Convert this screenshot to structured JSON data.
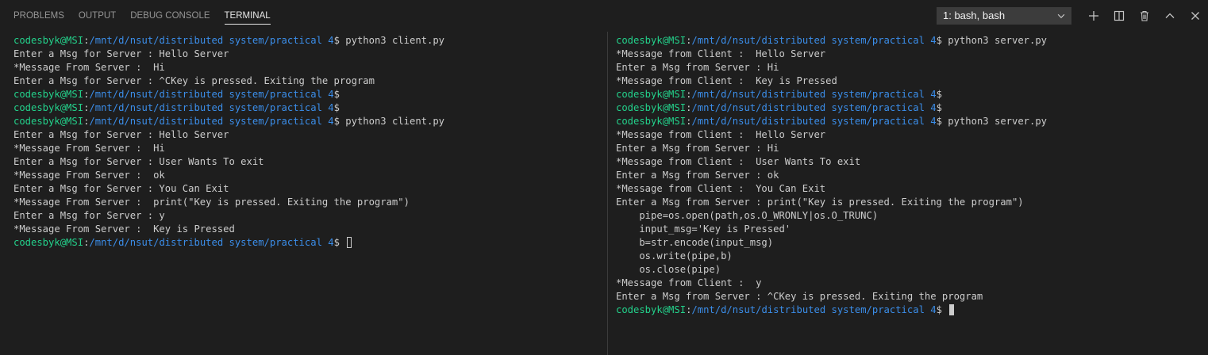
{
  "panel": {
    "tabs": [
      {
        "label": "PROBLEMS",
        "active": false
      },
      {
        "label": "OUTPUT",
        "active": false
      },
      {
        "label": "DEBUG CONSOLE",
        "active": false
      },
      {
        "label": "TERMINAL",
        "active": true
      }
    ],
    "terminal_select": {
      "selected": "1: bash, bash"
    },
    "icons": {
      "new_terminal": "plus-icon",
      "split": "split-editor-icon",
      "kill": "trash-icon",
      "maximize": "chevron-up-icon",
      "close": "close-icon"
    }
  },
  "colors": {
    "background": "#1e1e1e",
    "prompt_user": "#23d18b",
    "prompt_path": "#3b8eea",
    "text": "#cccccc"
  },
  "prompt": {
    "user": "codesbyk@MSI",
    "sep": ":",
    "path": "/mnt/d/nsut/distributed system/practical 4",
    "symbol": "$ "
  },
  "terminals": {
    "left": {
      "lines": [
        {
          "type": "prompt",
          "cmd": "python3 client.py"
        },
        {
          "type": "out",
          "text": "Enter a Msg for Server : Hello Server"
        },
        {
          "type": "out",
          "text": "*Message From Server :  Hi"
        },
        {
          "type": "out",
          "text": "Enter a Msg for Server : ^CKey is pressed. Exiting the program"
        },
        {
          "type": "prompt",
          "cmd": ""
        },
        {
          "type": "prompt",
          "cmd": ""
        },
        {
          "type": "prompt",
          "cmd": "python3 client.py"
        },
        {
          "type": "out",
          "text": "Enter a Msg for Server : Hello Server"
        },
        {
          "type": "out",
          "text": "*Message From Server :  Hi"
        },
        {
          "type": "out",
          "text": "Enter a Msg for Server : User Wants To exit"
        },
        {
          "type": "out",
          "text": "*Message From Server :  ok"
        },
        {
          "type": "out",
          "text": "Enter a Msg for Server : You Can Exit"
        },
        {
          "type": "out",
          "text": "*Message From Server :  print(\"Key is pressed. Exiting the program\")"
        },
        {
          "type": "out",
          "text": "Enter a Msg for Server : y"
        },
        {
          "type": "out",
          "text": "*Message From Server :  Key is Pressed"
        },
        {
          "type": "prompt",
          "cmd": "",
          "cursor": "hollow"
        }
      ]
    },
    "right": {
      "lines": [
        {
          "type": "prompt",
          "cmd": "python3 server.py"
        },
        {
          "type": "out",
          "text": "*Message from Client :  Hello Server"
        },
        {
          "type": "out",
          "text": "Enter a Msg from Server : Hi"
        },
        {
          "type": "out",
          "text": "*Message from Client :  Key is Pressed"
        },
        {
          "type": "prompt",
          "cmd": ""
        },
        {
          "type": "prompt",
          "cmd": ""
        },
        {
          "type": "prompt",
          "cmd": "python3 server.py"
        },
        {
          "type": "out",
          "text": "*Message from Client :  Hello Server"
        },
        {
          "type": "out",
          "text": "Enter a Msg from Server : Hi"
        },
        {
          "type": "out",
          "text": "*Message from Client :  User Wants To exit"
        },
        {
          "type": "out",
          "text": "Enter a Msg from Server : ok"
        },
        {
          "type": "out",
          "text": "*Message from Client :  You Can Exit"
        },
        {
          "type": "out",
          "text": "Enter a Msg from Server : print(\"Key is pressed. Exiting the program\")"
        },
        {
          "type": "out",
          "text": "    pipe=os.open(path,os.O_WRONLY|os.O_TRUNC)"
        },
        {
          "type": "out",
          "text": "    input_msg='Key is Pressed'"
        },
        {
          "type": "out",
          "text": "    b=str.encode(input_msg)"
        },
        {
          "type": "out",
          "text": "    os.write(pipe,b)"
        },
        {
          "type": "out",
          "text": "    os.close(pipe)"
        },
        {
          "type": "out",
          "text": "*Message from Client :  y"
        },
        {
          "type": "out",
          "text": "Enter a Msg from Server : ^CKey is pressed. Exiting the program"
        },
        {
          "type": "prompt",
          "cmd": "",
          "cursor": "solid"
        }
      ]
    }
  }
}
